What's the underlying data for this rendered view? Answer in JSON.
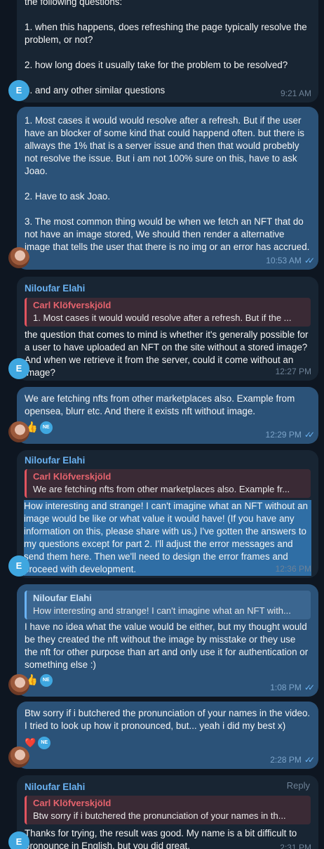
{
  "messages": [
    {
      "text": "the following questions:\n\n1. when this happens, does refreshing the page typically resolve the problem, or not?\n\n2. how long does it usually take for the problem to be resolved?\n\n3. and any other similar questions",
      "time": "9:21 AM",
      "avatar": "E"
    },
    {
      "text": "1. Most cases it would would resolve after a refresh. But if the user have an blocker of some kind that could happend often. but there is allways the 1% that is a server issue and then that would probebly not resolve the issue. But i am not 100% sure on this, have to ask Joao.\n\n2. Have to ask Joao.\n\n3. The most common thing would be when we fetch an NFT that do not have an image stored, We should then render a alternative image that tells the user that there is no img or an error has accrued.",
      "time": "10:53 AM"
    },
    {
      "sender": "Niloufar Elahi",
      "quote_name": "Carl Klöfverskjöld",
      "quote_text": "1. Most cases it would would resolve after a refresh. But if the ...",
      "text": "the question that comes to mind is whether it's generally possible for a user to have uploaded an NFT on the site without a stored image? And when we retrieve it from the server, could it come without an image?",
      "time": "12:27 PM",
      "avatar": "E"
    },
    {
      "text": "We are fetching nfts from other marketplaces also. Example from opensea, blurr etc. And there it exists nft without image.",
      "time": "12:29 PM",
      "reaction": "👍",
      "badge": "NE"
    },
    {
      "sender": "Niloufar Elahi",
      "quote_name": "Carl Klöfverskjöld",
      "quote_text": "We are fetching nfts from other marketplaces also. Example fr...",
      "text": "How interesting and strange! I can't imagine what an NFT without an image would be like or what value it would have! (If you have any information on this, please share with us.) I've gotten the answers to my questions except for part 2. I'll adjust the error messages and send them here. Then we'll need to design the error frames and proceed with development.",
      "time": "12:36 PM",
      "avatar": "E"
    },
    {
      "quote_name": "Niloufar Elahi",
      "quote_text": "How interesting and strange! I can't imagine what an NFT with...",
      "text": "I have no idea what the value would be either, but my thought would be they created the nft without the image by misstake or they use the nft for other purpose than art and only use it for authentication or something else :)",
      "time": "1:08 PM",
      "reaction": "👍",
      "badge": "NE"
    },
    {
      "text": "Btw sorry if i butchered the pronunciation of your names in the video. I tried to look up how it pronounced, but... yeah  i did my best x)",
      "time": "2:28 PM",
      "reaction": "❤️",
      "badge": "NE"
    },
    {
      "sender": "Niloufar Elahi",
      "reply_label": "Reply",
      "quote_name": "Carl Klöfverskjöld",
      "quote_text": "Btw sorry if i butchered the pronunciation of your names in th...",
      "text": "Thanks for trying, the result was good. My name is a bit difficult to pronounce in English, but you did great.",
      "time": "2:31 PM",
      "avatar": "E"
    }
  ],
  "colors": {
    "background": "#0e1621",
    "incoming": "#182533",
    "outgoing": "#2b5278",
    "accent": "#6ab2f2",
    "quote_red": "#e6636d"
  }
}
